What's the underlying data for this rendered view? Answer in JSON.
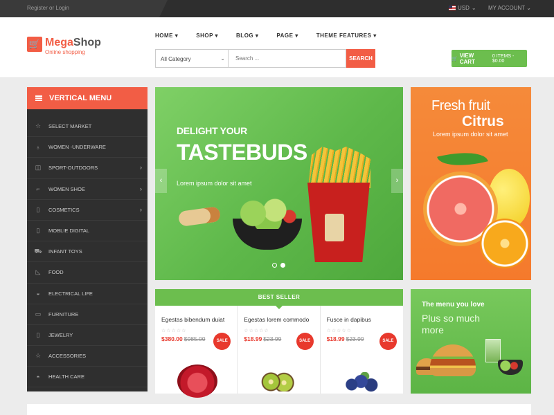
{
  "topbar": {
    "login_text": "Register or Login",
    "currency": "USD",
    "account": "MY ACCOUNT"
  },
  "header": {
    "logo_name_prefix": "Mega",
    "logo_name_suffix": "Shop",
    "logo_tagline": "Online shopping",
    "nav": [
      "HOME",
      "SHOP",
      "BLOG",
      "PAGE",
      "THEME FEATURES"
    ],
    "category_selected": "All Category",
    "search_placeholder": "Search ...",
    "search_button": "SEARCH",
    "cart_label": "VIEW CART",
    "cart_summary": "0 ITEMS - $0.00"
  },
  "vertical_menu": {
    "title": "VERTICAL MENU",
    "items": [
      {
        "label": "SELECT MARKET",
        "icon": "star-icon",
        "has_submenu": false
      },
      {
        "label": "WOMEN -UNDERWARE",
        "icon": "ring-icon",
        "has_submenu": false
      },
      {
        "label": "SPORT-OUTDOORS",
        "icon": "cup-icon",
        "has_submenu": true
      },
      {
        "label": "WOMEN SHOE",
        "icon": "shoe-icon",
        "has_submenu": true
      },
      {
        "label": "COSMETICS",
        "icon": "lipstick-icon",
        "has_submenu": true
      },
      {
        "label": "MOBLIE DIGITAL",
        "icon": "phone-icon",
        "has_submenu": false
      },
      {
        "label": "INFANT TOYS",
        "icon": "stroller-icon",
        "has_submenu": false
      },
      {
        "label": "FOOD",
        "icon": "boot-icon",
        "has_submenu": false
      },
      {
        "label": "ELECTRICAL LIFE",
        "icon": "pot-icon",
        "has_submenu": false
      },
      {
        "label": "FURNITURE",
        "icon": "tablet-icon",
        "has_submenu": false
      },
      {
        "label": "JEWELRY",
        "icon": "bottle-icon",
        "has_submenu": false
      },
      {
        "label": "ACCESSORIES",
        "icon": "star-icon",
        "has_submenu": false
      },
      {
        "label": "HEALTH CARE",
        "icon": "bag-icon",
        "has_submenu": false
      }
    ]
  },
  "slider": {
    "line1": "DELIGHT YOUR",
    "line2": "TASTEBUDS",
    "line3": "Lorem ipsum dolor sit amet"
  },
  "citrus_banner": {
    "line1": "Fresh fruit",
    "line2": "Citrus",
    "line3": "Lorem ipsum dolor sit amet"
  },
  "best_seller": {
    "title": "BEST SELLER",
    "products": [
      {
        "name": "Egestas bibendum duiat",
        "price": "$380.00",
        "old_price": "$985.00",
        "badge": "SALE",
        "stars": "☆☆☆☆☆"
      },
      {
        "name": "Egestas lorem commodo",
        "price": "$18.99",
        "old_price": "$23.99",
        "badge": "SALE",
        "stars": "☆☆☆☆☆"
      },
      {
        "name": "Fusce in dapibus",
        "price": "$18.99",
        "old_price": "$23.99",
        "badge": "SALE",
        "stars": "☆☆☆☆☆"
      }
    ]
  },
  "burger_banner": {
    "line1": "The menu you love",
    "line2": "Plus so much more"
  },
  "colors": {
    "accent": "#f25d45",
    "green": "#6cbe4e",
    "sale": "#e8392d",
    "orange_banner": "#f57a2c"
  }
}
